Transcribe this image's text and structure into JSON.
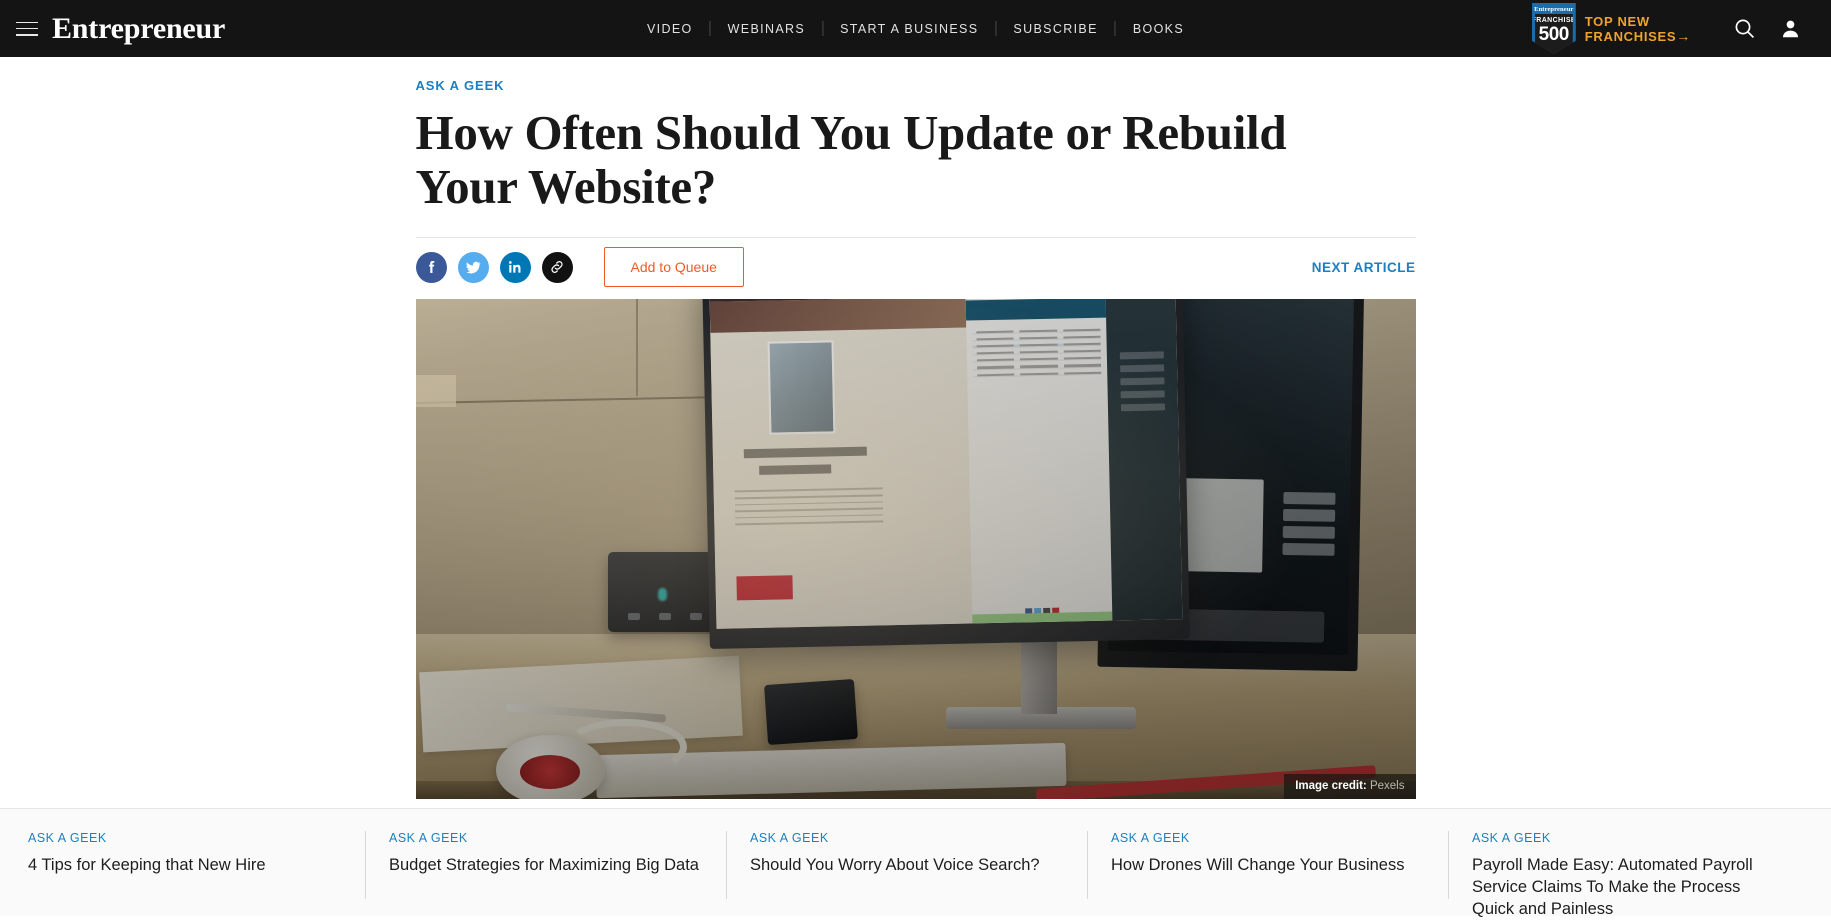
{
  "header": {
    "brand": "Entrepreneur",
    "menu_icon": "hamburger-icon",
    "nav": [
      {
        "label": "VIDEO"
      },
      {
        "label": "WEBINARS"
      },
      {
        "label": "START A BUSINESS"
      },
      {
        "label": "SUBSCRIBE"
      },
      {
        "label": "BOOKS"
      }
    ],
    "promo": {
      "badge_top": "Entrepreneur",
      "badge_mid": "FRANCHISE",
      "badge_number": "500",
      "line1": "TOP NEW",
      "line2": "FRANCHISES",
      "arrow": "→",
      "accent_color": "#f0a22e",
      "badge_color": "#1b6ca8"
    },
    "search_icon": "search-icon",
    "account_icon": "user-icon",
    "background_color": "#141414"
  },
  "article": {
    "kicker": "ASK A GEEK",
    "kicker_color": "#1b7fc0",
    "title": "How Often Should You Update or Rebuild Your Website?",
    "share": [
      {
        "name": "facebook",
        "label": "Share on Facebook",
        "color": "#3b5998"
      },
      {
        "name": "twitter",
        "label": "Share on Twitter",
        "color": "#55acee"
      },
      {
        "name": "linkedin",
        "label": "Share on LinkedIn",
        "color": "#0077b5"
      },
      {
        "name": "copy-link",
        "label": "Copy link",
        "color": "#111111"
      }
    ],
    "queue_button": "Add to Queue",
    "queue_color": "#f05a28",
    "next_article": "NEXT ARTICLE",
    "hero": {
      "credit_label": "Image credit:",
      "credit_source": "Pexels",
      "alt": "iMac desktop computer on a desk with keyboard, phone, router, Apple Airport and white headphones"
    }
  },
  "related": {
    "items": [
      {
        "kicker": "ASK A GEEK",
        "title": "4 Tips for Keeping that New Hire"
      },
      {
        "kicker": "ASK A GEEK",
        "title": "Budget Strategies for Maximizing Big Data"
      },
      {
        "kicker": "ASK A GEEK",
        "title": "Should You Worry About Voice Search?"
      },
      {
        "kicker": "ASK A GEEK",
        "title": "How Drones Will Change Your Business"
      },
      {
        "kicker": "ASK A GEEK",
        "title": "Payroll Made Easy: Automated Payroll Service Claims To Make the Process Quick and Painless"
      }
    ]
  }
}
